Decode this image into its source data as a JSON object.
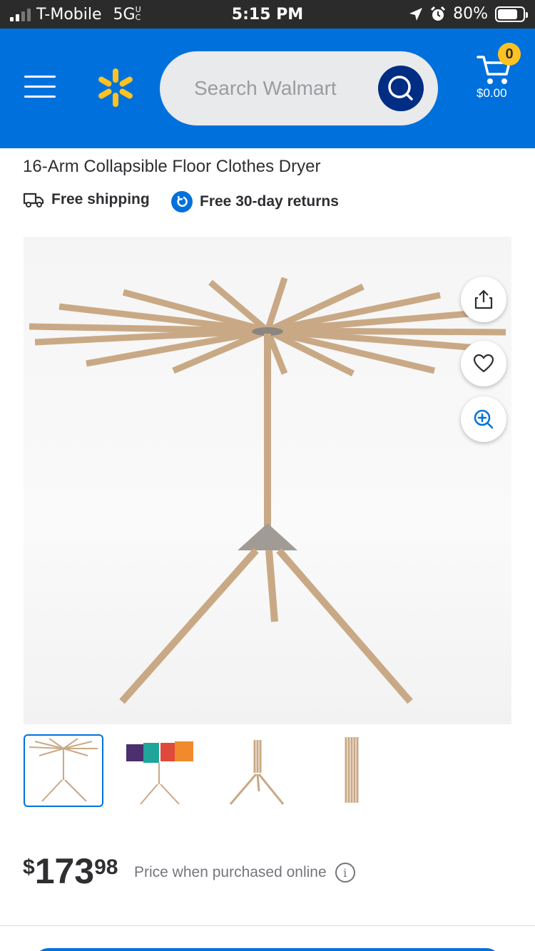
{
  "status_bar": {
    "carrier": "T-Mobile",
    "network": "5G",
    "network_sub": "UC",
    "time": "5:15 PM",
    "battery": "80%",
    "battery_level": 0.8
  },
  "header": {
    "search_placeholder": "Search Walmart",
    "cart_count": "0",
    "cart_total": "$0.00",
    "brand_color": "#0071dc",
    "spark_color": "#ffc220"
  },
  "product": {
    "title": "16-Arm Collapsible Floor Clothes Dryer",
    "badges": {
      "shipping": "Free shipping",
      "returns": "Free 30-day returns"
    },
    "price": {
      "currency": "$",
      "dollars": "173",
      "cents": "98",
      "note": "Price when purchased online",
      "info_icon": "i"
    }
  },
  "gallery": {
    "thumbnail_count": 4,
    "selected_index": 0,
    "actions": [
      "share-icon",
      "heart-icon",
      "zoom-in-icon"
    ]
  }
}
